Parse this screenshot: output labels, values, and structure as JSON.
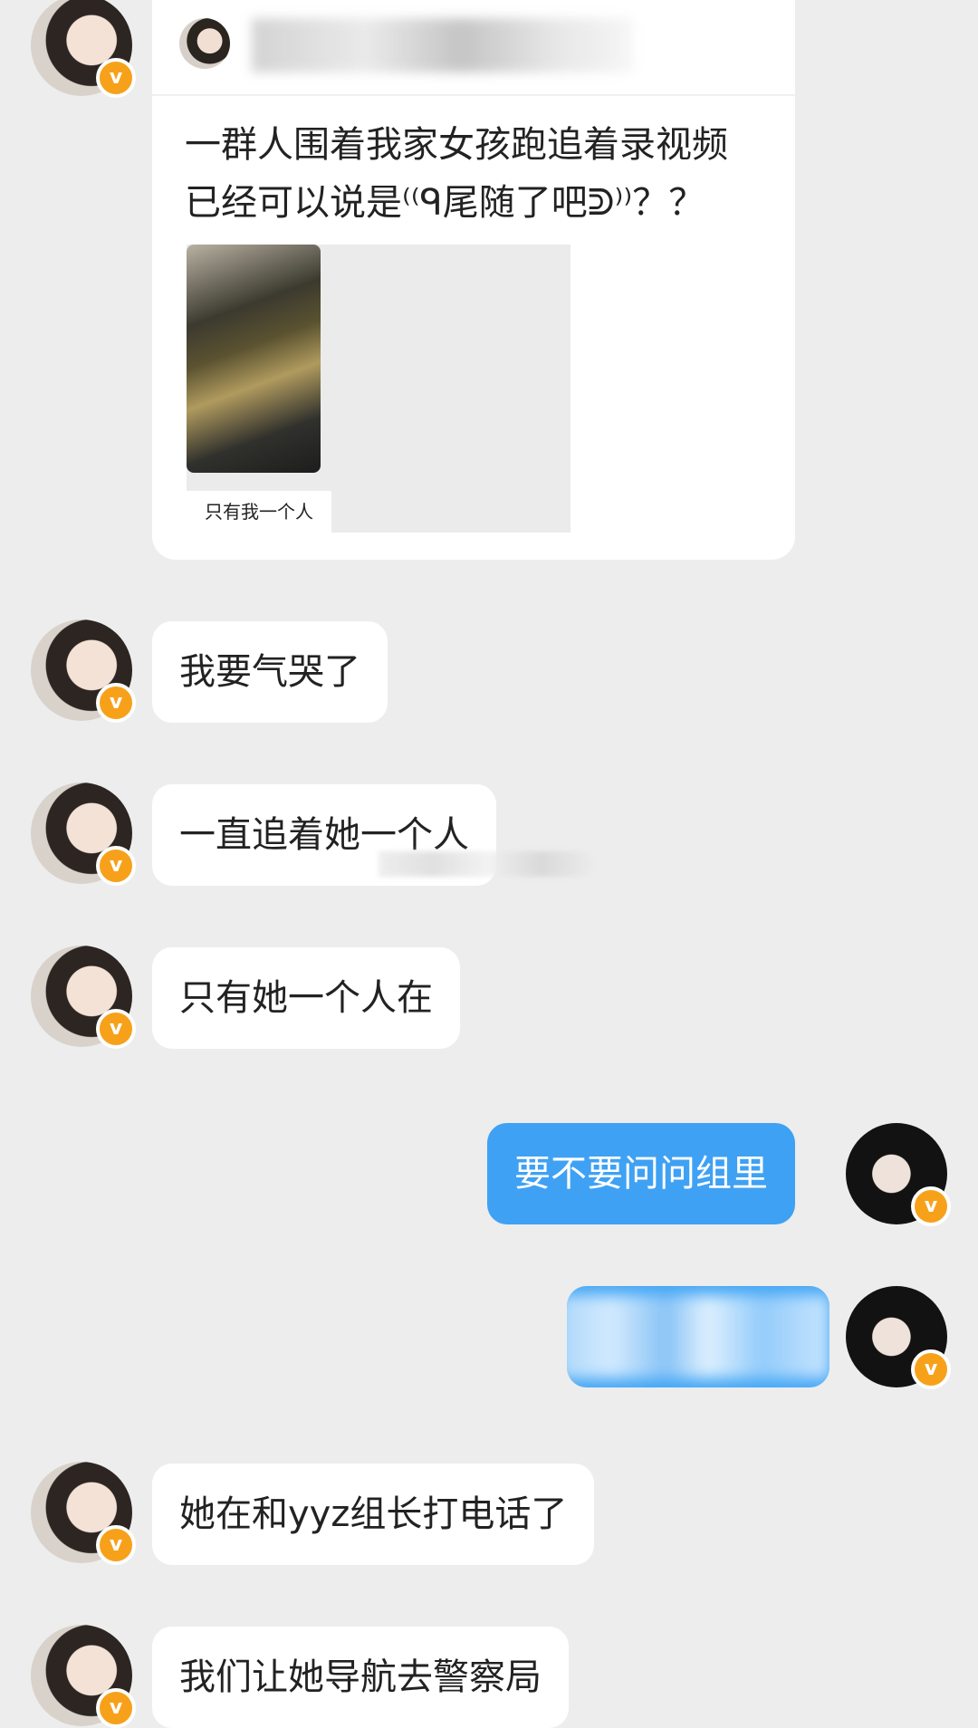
{
  "shared_post": {
    "text_line1": "一群人围着我家女孩跑追着录视频",
    "text_line2": "已经可以说是⁽⁽ᑫ尾随了吧ᕲ⁾⁾？？",
    "media_caption": "只有我一个人"
  },
  "messages": [
    {
      "side": "left",
      "text": "我要气哭了"
    },
    {
      "side": "left",
      "text": "一直追着她一个人"
    },
    {
      "side": "left",
      "text": "只有她一个人在"
    },
    {
      "side": "right",
      "text": "要不要问问组里"
    },
    {
      "side": "right",
      "text": ""
    },
    {
      "side": "left",
      "text": "她在和yyz组长打电话了"
    },
    {
      "side": "left",
      "text": "我们让她导航去警察局"
    }
  ],
  "badges": {
    "verified_symbol": "v"
  },
  "colors": {
    "background": "#ededed",
    "right_bubble": "#3fa1f4",
    "verified_badge": "#f7a11a"
  }
}
